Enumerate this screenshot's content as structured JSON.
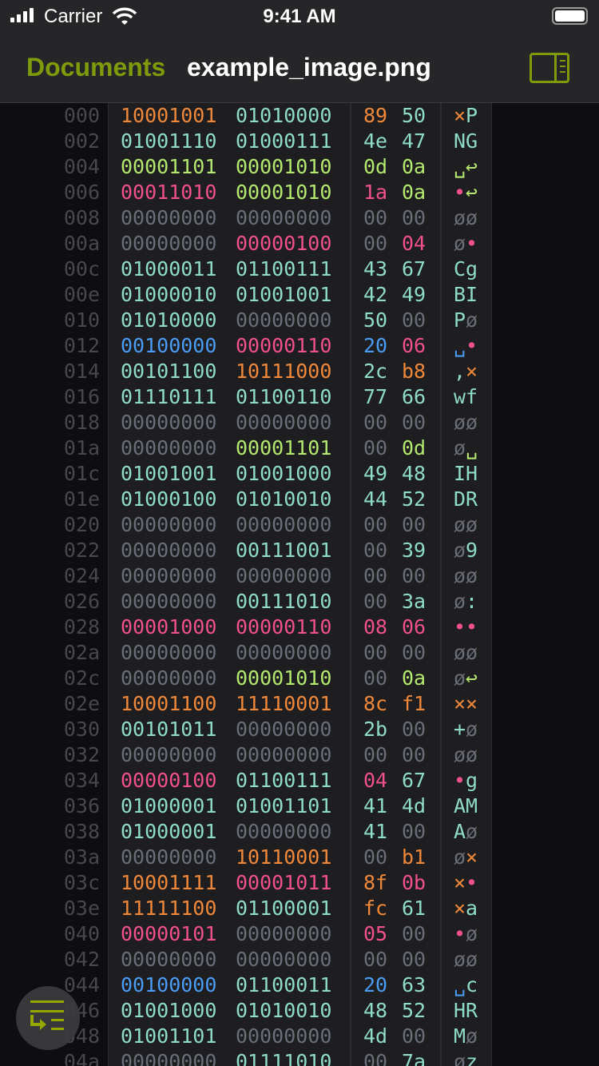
{
  "status": {
    "carrier": "Carrier",
    "time": "9:41 AM"
  },
  "nav": {
    "back": "Documents",
    "title": "example_image.png"
  },
  "colors": {
    "accent": "#7f9a0a",
    "high": "#f0883a",
    "print": "#8fdcc6",
    "ws": "#b4e86e",
    "ctrl": "#f0508c",
    "null": "#6a6e78",
    "space": "#4a9cf4"
  },
  "rows": [
    {
      "addr": "000",
      "b": [
        [
          "10001001",
          "89",
          "×"
        ],
        [
          "01010000",
          "50",
          "P"
        ]
      ]
    },
    {
      "addr": "002",
      "b": [
        [
          "01001110",
          "4e",
          "N"
        ],
        [
          "01000111",
          "47",
          "G"
        ]
      ]
    },
    {
      "addr": "004",
      "b": [
        [
          "00001101",
          "0d",
          "␣"
        ],
        [
          "00001010",
          "0a",
          "↩"
        ]
      ]
    },
    {
      "addr": "006",
      "b": [
        [
          "00011010",
          "1a",
          "•"
        ],
        [
          "00001010",
          "0a",
          "↩"
        ]
      ]
    },
    {
      "addr": "008",
      "b": [
        [
          "00000000",
          "00",
          "ø"
        ],
        [
          "00000000",
          "00",
          "ø"
        ]
      ]
    },
    {
      "addr": "00a",
      "b": [
        [
          "00000000",
          "00",
          "ø"
        ],
        [
          "00000100",
          "04",
          "•"
        ]
      ]
    },
    {
      "addr": "00c",
      "b": [
        [
          "01000011",
          "43",
          "C"
        ],
        [
          "01100111",
          "67",
          "g"
        ]
      ]
    },
    {
      "addr": "00e",
      "b": [
        [
          "01000010",
          "42",
          "B"
        ],
        [
          "01001001",
          "49",
          "I"
        ]
      ]
    },
    {
      "addr": "010",
      "b": [
        [
          "01010000",
          "50",
          "P"
        ],
        [
          "00000000",
          "00",
          "ø"
        ]
      ]
    },
    {
      "addr": "012",
      "b": [
        [
          "00100000",
          "20",
          "␣"
        ],
        [
          "00000110",
          "06",
          "•"
        ]
      ]
    },
    {
      "addr": "014",
      "b": [
        [
          "00101100",
          "2c",
          ","
        ],
        [
          "10111000",
          "b8",
          "×"
        ]
      ]
    },
    {
      "addr": "016",
      "b": [
        [
          "01110111",
          "77",
          "w"
        ],
        [
          "01100110",
          "66",
          "f"
        ]
      ]
    },
    {
      "addr": "018",
      "b": [
        [
          "00000000",
          "00",
          "ø"
        ],
        [
          "00000000",
          "00",
          "ø"
        ]
      ]
    },
    {
      "addr": "01a",
      "b": [
        [
          "00000000",
          "00",
          "ø"
        ],
        [
          "00001101",
          "0d",
          "␣"
        ]
      ]
    },
    {
      "addr": "01c",
      "b": [
        [
          "01001001",
          "49",
          "I"
        ],
        [
          "01001000",
          "48",
          "H"
        ]
      ]
    },
    {
      "addr": "01e",
      "b": [
        [
          "01000100",
          "44",
          "D"
        ],
        [
          "01010010",
          "52",
          "R"
        ]
      ]
    },
    {
      "addr": "020",
      "b": [
        [
          "00000000",
          "00",
          "ø"
        ],
        [
          "00000000",
          "00",
          "ø"
        ]
      ]
    },
    {
      "addr": "022",
      "b": [
        [
          "00000000",
          "00",
          "ø"
        ],
        [
          "00111001",
          "39",
          "9"
        ]
      ]
    },
    {
      "addr": "024",
      "b": [
        [
          "00000000",
          "00",
          "ø"
        ],
        [
          "00000000",
          "00",
          "ø"
        ]
      ]
    },
    {
      "addr": "026",
      "b": [
        [
          "00000000",
          "00",
          "ø"
        ],
        [
          "00111010",
          "3a",
          ":"
        ]
      ]
    },
    {
      "addr": "028",
      "b": [
        [
          "00001000",
          "08",
          "•"
        ],
        [
          "00000110",
          "06",
          "•"
        ]
      ]
    },
    {
      "addr": "02a",
      "b": [
        [
          "00000000",
          "00",
          "ø"
        ],
        [
          "00000000",
          "00",
          "ø"
        ]
      ]
    },
    {
      "addr": "02c",
      "b": [
        [
          "00000000",
          "00",
          "ø"
        ],
        [
          "00001010",
          "0a",
          "↩"
        ]
      ]
    },
    {
      "addr": "02e",
      "b": [
        [
          "10001100",
          "8c",
          "×"
        ],
        [
          "11110001",
          "f1",
          "×"
        ]
      ]
    },
    {
      "addr": "030",
      "b": [
        [
          "00101011",
          "2b",
          "+"
        ],
        [
          "00000000",
          "00",
          "ø"
        ]
      ]
    },
    {
      "addr": "032",
      "b": [
        [
          "00000000",
          "00",
          "ø"
        ],
        [
          "00000000",
          "00",
          "ø"
        ]
      ]
    },
    {
      "addr": "034",
      "b": [
        [
          "00000100",
          "04",
          "•"
        ],
        [
          "01100111",
          "67",
          "g"
        ]
      ]
    },
    {
      "addr": "036",
      "b": [
        [
          "01000001",
          "41",
          "A"
        ],
        [
          "01001101",
          "4d",
          "M"
        ]
      ]
    },
    {
      "addr": "038",
      "b": [
        [
          "01000001",
          "41",
          "A"
        ],
        [
          "00000000",
          "00",
          "ø"
        ]
      ]
    },
    {
      "addr": "03a",
      "b": [
        [
          "00000000",
          "00",
          "ø"
        ],
        [
          "10110001",
          "b1",
          "×"
        ]
      ]
    },
    {
      "addr": "03c",
      "b": [
        [
          "10001111",
          "8f",
          "×"
        ],
        [
          "00001011",
          "0b",
          "•"
        ]
      ]
    },
    {
      "addr": "03e",
      "b": [
        [
          "11111100",
          "fc",
          "×"
        ],
        [
          "01100001",
          "61",
          "a"
        ]
      ]
    },
    {
      "addr": "040",
      "b": [
        [
          "00000101",
          "05",
          "•"
        ],
        [
          "00000000",
          "00",
          "ø"
        ]
      ]
    },
    {
      "addr": "042",
      "b": [
        [
          "00000000",
          "00",
          "ø"
        ],
        [
          "00000000",
          "00",
          "ø"
        ]
      ]
    },
    {
      "addr": "044",
      "b": [
        [
          "00100000",
          "20",
          "␣"
        ],
        [
          "01100011",
          "63",
          "c"
        ]
      ]
    },
    {
      "addr": "046",
      "b": [
        [
          "01001000",
          "48",
          "H"
        ],
        [
          "01010010",
          "52",
          "R"
        ]
      ]
    },
    {
      "addr": "048",
      "b": [
        [
          "01001101",
          "4d",
          "M"
        ],
        [
          "00000000",
          "00",
          "ø"
        ]
      ]
    },
    {
      "addr": "04a",
      "b": [
        [
          "00000000",
          "00",
          "ø"
        ],
        [
          "01111010",
          "7a",
          "z"
        ]
      ]
    }
  ]
}
